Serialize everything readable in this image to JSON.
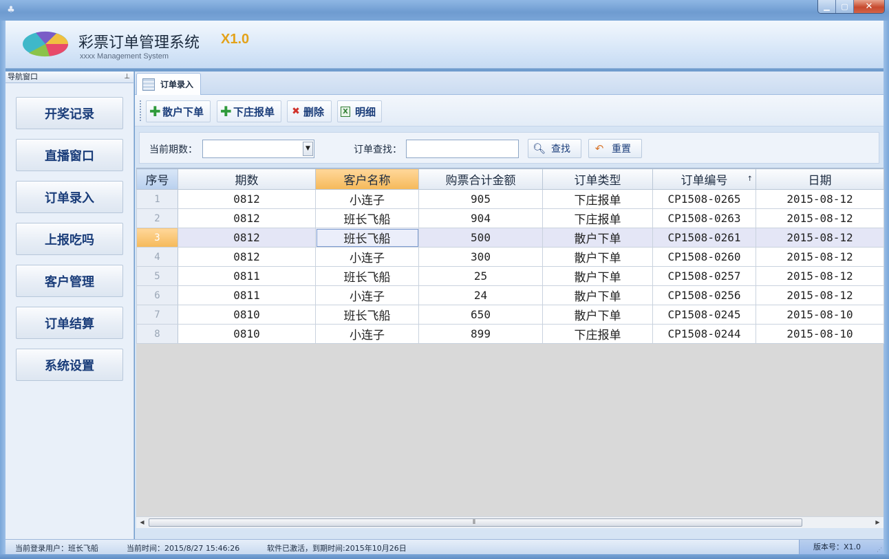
{
  "window": {
    "minimize": "▁",
    "maximize": "▢",
    "close": "✕"
  },
  "header": {
    "title": "彩票订单管理系统",
    "version": "X1.0",
    "subtitle": "xxxx Management System"
  },
  "nav": {
    "title": "导航窗口",
    "pin": "ꟷ",
    "items": [
      {
        "label": "开奖记录"
      },
      {
        "label": "直播窗口"
      },
      {
        "label": "订单录入"
      },
      {
        "label": "上报吃吗"
      },
      {
        "label": "客户管理"
      },
      {
        "label": "订单结算"
      },
      {
        "label": "系统设置"
      }
    ]
  },
  "tab": {
    "label": "订单录入"
  },
  "toolbar": {
    "retail_order": "散户下单",
    "dealer_report": "下庄报单",
    "delete": "删除",
    "detail": "明细"
  },
  "search": {
    "period_label": "当前期数：",
    "period_value": "",
    "order_label": "订单查找：",
    "order_value": "",
    "find": "查找",
    "reset": "重置"
  },
  "grid": {
    "columns": [
      "序号",
      "期数",
      "客户名称",
      "购票合计金额",
      "订单类型",
      "订单编号",
      "日期"
    ],
    "sort_indicator": "↑",
    "rows": [
      {
        "no": "1",
        "period": "0812",
        "customer": "小连子",
        "amount": "905",
        "type": "下庄报单",
        "order_id": "CP1508-0265",
        "date": "2015-08-12"
      },
      {
        "no": "2",
        "period": "0812",
        "customer": "班长飞船",
        "amount": "904",
        "type": "下庄报单",
        "order_id": "CP1508-0263",
        "date": "2015-08-12"
      },
      {
        "no": "3",
        "period": "0812",
        "customer": "班长飞船",
        "amount": "500",
        "type": "散户下单",
        "order_id": "CP1508-0261",
        "date": "2015-08-12"
      },
      {
        "no": "4",
        "period": "0812",
        "customer": "小连子",
        "amount": "300",
        "type": "散户下单",
        "order_id": "CP1508-0260",
        "date": "2015-08-12"
      },
      {
        "no": "5",
        "period": "0811",
        "customer": "班长飞船",
        "amount": "25",
        "type": "散户下单",
        "order_id": "CP1508-0257",
        "date": "2015-08-12"
      },
      {
        "no": "6",
        "period": "0811",
        "customer": "小连子",
        "amount": "24",
        "type": "散户下单",
        "order_id": "CP1508-0256",
        "date": "2015-08-12"
      },
      {
        "no": "7",
        "period": "0810",
        "customer": "班长飞船",
        "amount": "650",
        "type": "散户下单",
        "order_id": "CP1508-0245",
        "date": "2015-08-10"
      },
      {
        "no": "8",
        "period": "0810",
        "customer": "小连子",
        "amount": "899",
        "type": "下庄报单",
        "order_id": "CP1508-0244",
        "date": "2015-08-10"
      }
    ],
    "selected_row": 3
  },
  "status": {
    "user": "当前登录用户：班长飞船",
    "time": "当前时间：2015/8/27 15:46:26",
    "license": "软件已激活，到期时间:2015年10月26日",
    "version": "版本号：X1.0"
  },
  "colors": {
    "accent": "#e3a21a",
    "nav_text": "#1a3d7a",
    "selected_header": "#f5b95a"
  }
}
